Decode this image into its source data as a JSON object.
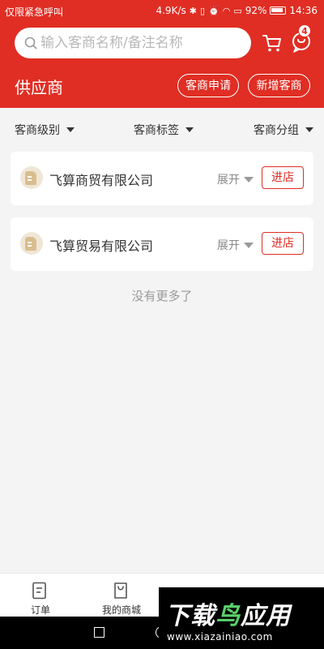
{
  "status_bar": {
    "left_text": "仅限紧急呼叫",
    "speed": "4.9K/s",
    "battery": "92%",
    "time": "14:36"
  },
  "search": {
    "placeholder": "输入客商名称/备注名称"
  },
  "header": {
    "title": "供应商",
    "message_badge": "4",
    "apply_label": "客商申请",
    "add_label": "新增客商"
  },
  "filters": [
    {
      "label": "客商级别"
    },
    {
      "label": "客商标签"
    },
    {
      "label": "客商分组"
    }
  ],
  "suppliers": [
    {
      "name": "飞算商贸有限公司",
      "expand_label": "展开",
      "enter_label": "进店"
    },
    {
      "name": "飞算贸易有限公司",
      "expand_label": "展开",
      "enter_label": "进店"
    }
  ],
  "no_more_text": "没有更多了",
  "tabbar": {
    "items": [
      {
        "label": "订单"
      },
      {
        "label": "我的商城"
      }
    ]
  },
  "watermark": {
    "brand_white": "下载",
    "brand_green": "鸟",
    "brand_white2": "应用",
    "url": "www.xiazainiao.com"
  },
  "colors": {
    "accent": "#e02e24",
    "background": "#f4f4f4"
  }
}
